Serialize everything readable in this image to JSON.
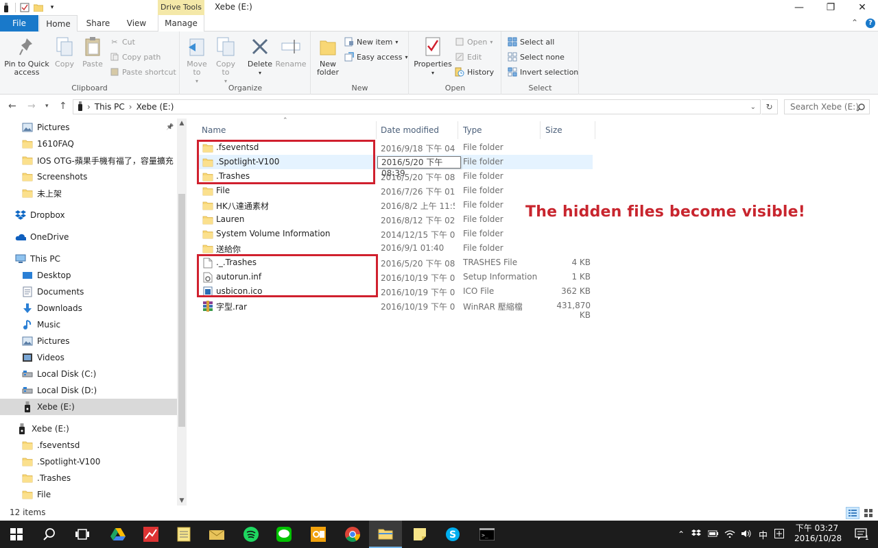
{
  "window": {
    "title": "Xebe (E:)",
    "context_tab": "Drive Tools",
    "controls": {
      "minimize": "—",
      "maximize": "❐",
      "close": "✕"
    }
  },
  "tabs": {
    "file": "File",
    "home": "Home",
    "share": "Share",
    "view": "View",
    "manage": "Manage",
    "collapse": "⌃",
    "help": "?"
  },
  "ribbon": {
    "clipboard": {
      "label": "Clipboard",
      "pin": "Pin to Quick access",
      "copy": "Copy",
      "paste": "Paste",
      "cut": "Cut",
      "copy_path": "Copy path",
      "paste_shortcut": "Paste shortcut"
    },
    "organize": {
      "label": "Organize",
      "move_to": "Move to",
      "copy_to": "Copy to",
      "delete": "Delete",
      "rename": "Rename"
    },
    "new": {
      "label": "New",
      "new_folder": "New folder",
      "new_item": "New item",
      "easy_access": "Easy access"
    },
    "open": {
      "label": "Open",
      "properties": "Properties",
      "open": "Open",
      "edit": "Edit",
      "history": "History"
    },
    "select": {
      "label": "Select",
      "select_all": "Select all",
      "select_none": "Select none",
      "invert": "Invert selection"
    }
  },
  "address": {
    "this_pc": "This PC",
    "drive": "Xebe (E:)",
    "sep": "›",
    "search_placeholder": "Search Xebe (E:)"
  },
  "nav": {
    "items": [
      {
        "label": "Pictures",
        "icon": "pictures-icon",
        "pinned": true
      },
      {
        "label": "1610FAQ",
        "icon": "folder-icon"
      },
      {
        "label": "IOS OTG-蘋果手機有福了，容量擴充",
        "icon": "folder-icon"
      },
      {
        "label": "Screenshots",
        "icon": "folder-icon"
      },
      {
        "label": "未上架",
        "icon": "folder-icon"
      },
      {
        "label": "Dropbox",
        "icon": "dropbox-icon"
      },
      {
        "label": "OneDrive",
        "icon": "onedrive-icon"
      },
      {
        "label": "This PC",
        "icon": "this-pc-icon"
      },
      {
        "label": "Desktop",
        "icon": "desktop-icon"
      },
      {
        "label": "Documents",
        "icon": "documents-icon"
      },
      {
        "label": "Downloads",
        "icon": "downloads-icon"
      },
      {
        "label": "Music",
        "icon": "music-icon"
      },
      {
        "label": "Pictures",
        "icon": "pictures-icon"
      },
      {
        "label": "Videos",
        "icon": "videos-icon"
      },
      {
        "label": "Local Disk (C:)",
        "icon": "disk-icon"
      },
      {
        "label": "Local Disk (D:)",
        "icon": "disk-icon"
      },
      {
        "label": "Xebe (E:)",
        "icon": "usb-drive-icon",
        "selected": true
      },
      {
        "label": "Xebe (E:)",
        "icon": "usb-drive-icon"
      },
      {
        "label": ".fseventsd",
        "icon": "folder-icon"
      },
      {
        "label": ".Spotlight-V100",
        "icon": "folder-icon"
      },
      {
        "label": ".Trashes",
        "icon": "folder-icon"
      },
      {
        "label": "File",
        "icon": "folder-icon"
      }
    ]
  },
  "columns": {
    "name": "Name",
    "date": "Date modified",
    "type": "Type",
    "size": "Size"
  },
  "files": [
    {
      "name": ".fseventsd",
      "date": "2016/9/18 下午 04...",
      "type": "File folder",
      "size": "",
      "icon": "folder-icon"
    },
    {
      "name": ".Spotlight-V100",
      "date": "2016/5/20 下午 08:39",
      "type": "File folder",
      "size": "",
      "icon": "folder-icon",
      "hover": true
    },
    {
      "name": ".Trashes",
      "date": "2016/5/20 下午 08...",
      "type": "File folder",
      "size": "",
      "icon": "folder-icon"
    },
    {
      "name": "File",
      "date": "2016/7/26 下午 01...",
      "type": "File folder",
      "size": "",
      "icon": "folder-icon"
    },
    {
      "name": "HK八達通素材",
      "date": "2016/8/2 上午 11:53",
      "type": "File folder",
      "size": "",
      "icon": "folder-icon"
    },
    {
      "name": "Lauren",
      "date": "2016/8/12 下午 02...",
      "type": "File folder",
      "size": "",
      "icon": "folder-icon"
    },
    {
      "name": "System Volume Information",
      "date": "2014/12/15 下午 0...",
      "type": "File folder",
      "size": "",
      "icon": "folder-icon"
    },
    {
      "name": "送給你",
      "date": "2016/9/1 01:40",
      "type": "File folder",
      "size": "",
      "icon": "folder-icon"
    },
    {
      "name": "._.Trashes",
      "date": "2016/5/20 下午 08...",
      "type": "TRASHES File",
      "size": "4 KB",
      "icon": "file-icon"
    },
    {
      "name": "autorun.inf",
      "date": "2016/10/19 下午 0...",
      "type": "Setup Information",
      "size": "1 KB",
      "icon": "settings-file-icon"
    },
    {
      "name": "usbicon.ico",
      "date": "2016/10/19 下午 0...",
      "type": "ICO File",
      "size": "362 KB",
      "icon": "image-file-icon"
    },
    {
      "name": "字型.rar",
      "date": "2016/10/19 下午 0...",
      "type": "WinRAR 壓縮檔",
      "size": "431,870 KB",
      "icon": "winrar-icon"
    }
  ],
  "tooltip": "2016/5/20 下午 08:39",
  "annotation": "The hidden files become visible!",
  "status": {
    "count": "12 items"
  },
  "taskbar": {
    "ime": "中",
    "time": "下午 03:27",
    "date": "2016/10/28",
    "notifications": "1"
  },
  "colors": {
    "accent": "#1979ca",
    "annotation_red": "#d0202e",
    "folder_yellow": "#f8d775"
  }
}
